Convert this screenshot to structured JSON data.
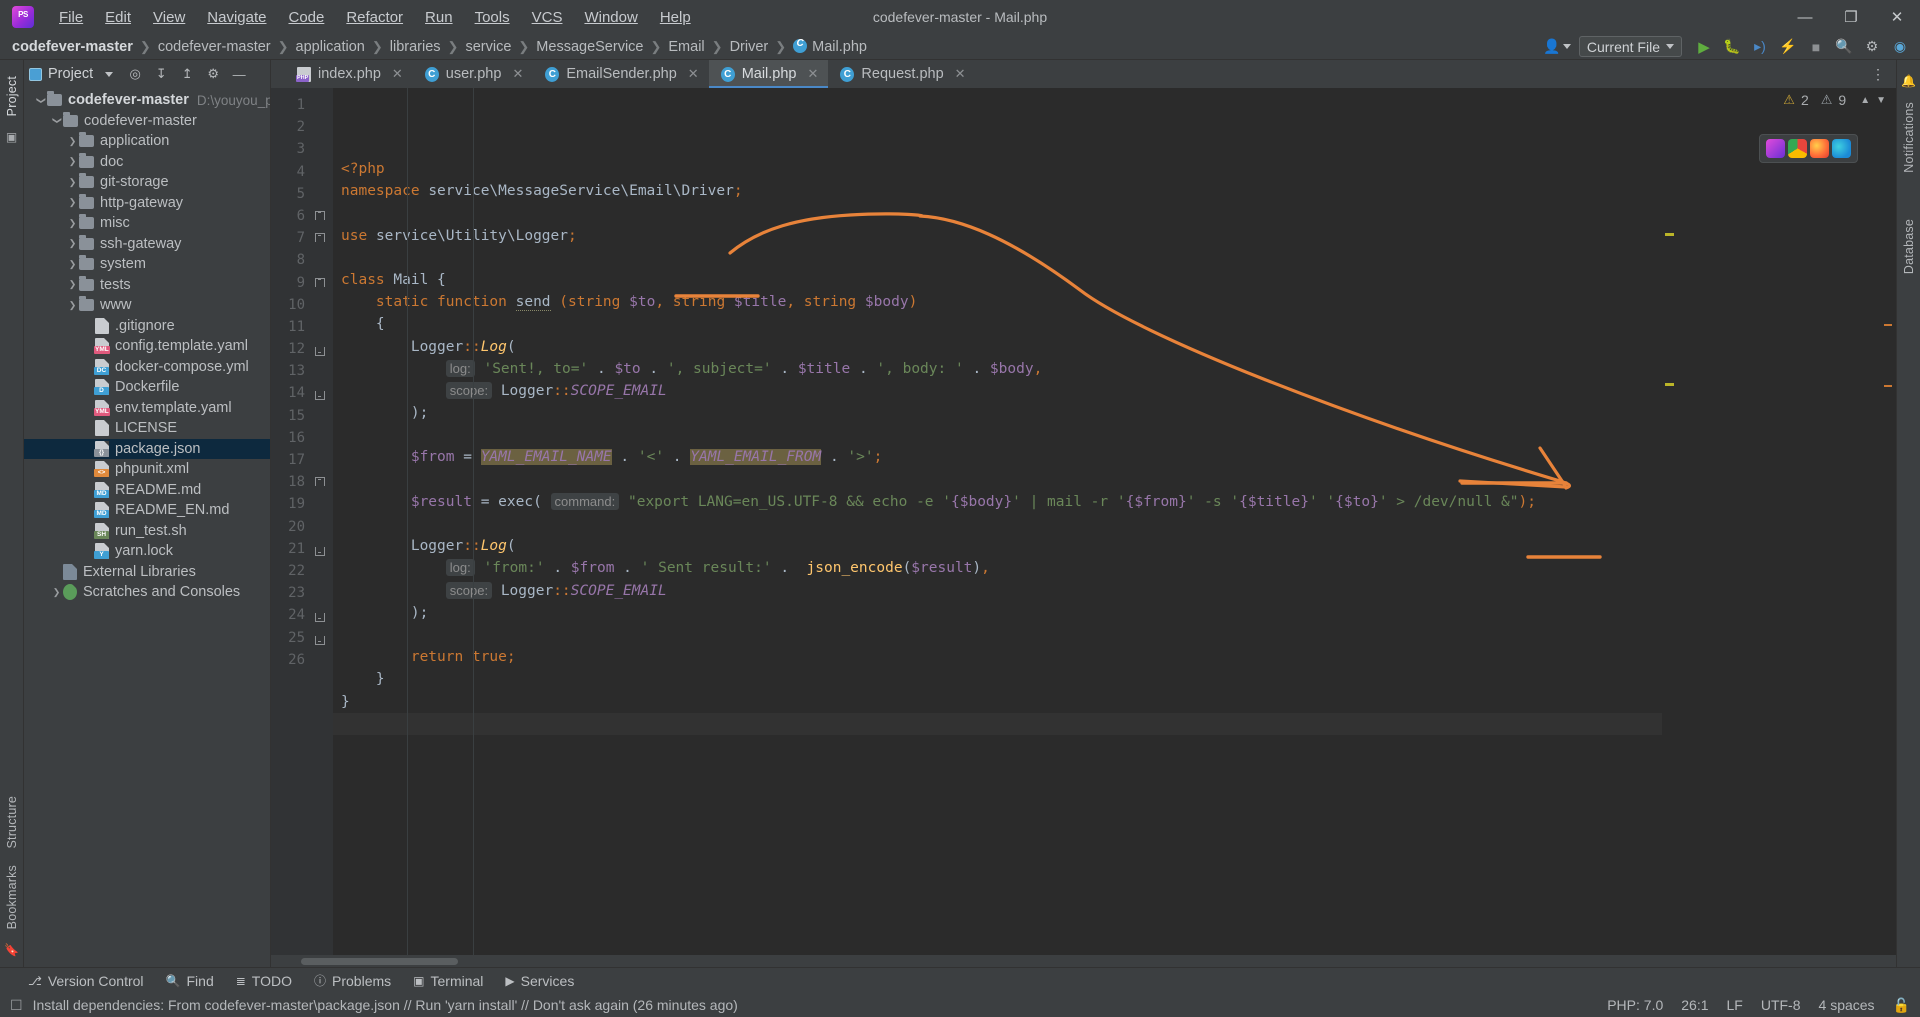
{
  "window": {
    "title": "codefever-master - Mail.php"
  },
  "menu": {
    "items": [
      "File",
      "Edit",
      "View",
      "Navigate",
      "Code",
      "Refactor",
      "Run",
      "Tools",
      "VCS",
      "Window",
      "Help"
    ]
  },
  "window_controls": {
    "minimize": "—",
    "maximize": "❐",
    "close": "✕"
  },
  "breadcrumb": {
    "items": [
      "codefever-master",
      "codefever-master",
      "application",
      "libraries",
      "service",
      "MessageService",
      "Email",
      "Driver"
    ],
    "file": "Mail.php",
    "separator": "❯"
  },
  "navbar_right": {
    "account_icon": "user-icon",
    "run_config": "Current File",
    "run": "run-icon",
    "debug": "debug-icon",
    "run_coverage": "run-coverage-icon",
    "profile": "profile-icon",
    "stop": "stop-icon",
    "search": "search-icon",
    "settings": "gear-icon",
    "plugin": "plugin-icon"
  },
  "rails": {
    "left_top": [
      "Project"
    ],
    "left_bottom": [
      "Structure",
      "Bookmarks"
    ],
    "right": [
      "Notifications",
      "Database"
    ]
  },
  "project_panel": {
    "title": "Project",
    "toolbar": [
      "dropdown-icon",
      "target-icon",
      "expand-all-icon",
      "collapse-all-icon",
      "gear-icon",
      "hide-icon"
    ],
    "tree": [
      {
        "label": "codefever-master",
        "path": "D:\\youyou_pm",
        "type": "root",
        "indent": 0,
        "arrow": "open",
        "bold": true,
        "selected": false
      },
      {
        "label": "codefever-master",
        "type": "folder",
        "indent": 1,
        "arrow": "open",
        "bold": false,
        "selected": false
      },
      {
        "label": "application",
        "type": "folder",
        "indent": 2,
        "arrow": "closed",
        "selected": false
      },
      {
        "label": "doc",
        "type": "folder",
        "indent": 2,
        "arrow": "closed",
        "selected": false
      },
      {
        "label": "git-storage",
        "type": "folder",
        "indent": 2,
        "arrow": "closed",
        "selected": false
      },
      {
        "label": "http-gateway",
        "type": "folder",
        "indent": 2,
        "arrow": "closed",
        "selected": false
      },
      {
        "label": "misc",
        "type": "folder",
        "indent": 2,
        "arrow": "closed",
        "selected": false
      },
      {
        "label": "ssh-gateway",
        "type": "folder",
        "indent": 2,
        "arrow": "closed",
        "selected": false
      },
      {
        "label": "system",
        "type": "folder",
        "indent": 2,
        "arrow": "closed",
        "selected": false
      },
      {
        "label": "tests",
        "type": "folder",
        "indent": 2,
        "arrow": "closed",
        "selected": false
      },
      {
        "label": "www",
        "type": "folder",
        "indent": 2,
        "arrow": "closed",
        "selected": false
      },
      {
        "label": ".gitignore",
        "type": "file",
        "tag": "",
        "tagcolor": "#8a9199",
        "indent": 3,
        "selected": false
      },
      {
        "label": "config.template.yaml",
        "type": "file",
        "tag": "YML",
        "tagcolor": "#e05a7d",
        "indent": 3,
        "selected": false
      },
      {
        "label": "docker-compose.yml",
        "type": "file",
        "tag": "DC",
        "tagcolor": "#3f9fd4",
        "indent": 3,
        "selected": false
      },
      {
        "label": "Dockerfile",
        "type": "file",
        "tag": "D",
        "tagcolor": "#3f9fd4",
        "indent": 3,
        "selected": false
      },
      {
        "label": "env.template.yaml",
        "type": "file",
        "tag": "YML",
        "tagcolor": "#e05a7d",
        "indent": 3,
        "selected": false
      },
      {
        "label": "LICENSE",
        "type": "file",
        "tag": "",
        "tagcolor": "#8a9199",
        "indent": 3,
        "selected": false
      },
      {
        "label": "package.json",
        "type": "file",
        "tag": "{}",
        "tagcolor": "#8a9199",
        "indent": 3,
        "selected": true
      },
      {
        "label": "phpunit.xml",
        "type": "file",
        "tag": "<>",
        "tagcolor": "#e08a3c",
        "indent": 3,
        "selected": false
      },
      {
        "label": "README.md",
        "type": "file",
        "tag": "MD",
        "tagcolor": "#3f9fd4",
        "indent": 3,
        "selected": false
      },
      {
        "label": "README_EN.md",
        "type": "file",
        "tag": "MD",
        "tagcolor": "#3f9fd4",
        "indent": 3,
        "selected": false
      },
      {
        "label": "run_test.sh",
        "type": "file",
        "tag": "SH",
        "tagcolor": "#6a8759",
        "indent": 3,
        "selected": false
      },
      {
        "label": "yarn.lock",
        "type": "file",
        "tag": "Y",
        "tagcolor": "#3f9fd4",
        "indent": 3,
        "selected": false
      },
      {
        "label": "External Libraries",
        "type": "lib",
        "indent": 1,
        "selected": false
      },
      {
        "label": "Scratches and Consoles",
        "type": "scratch",
        "indent": 1,
        "arrow": "closed",
        "selected": false
      }
    ]
  },
  "tabs": [
    {
      "label": "index.php",
      "icon": "php-file-icon",
      "active": false,
      "closeable": true
    },
    {
      "label": "user.php",
      "icon": "php-class-icon",
      "active": false,
      "closeable": true
    },
    {
      "label": "EmailSender.php",
      "icon": "php-class-icon",
      "active": false,
      "closeable": true
    },
    {
      "label": "Mail.php",
      "icon": "php-class-icon",
      "active": true,
      "closeable": true
    },
    {
      "label": "Request.php",
      "icon": "php-class-icon",
      "active": false,
      "closeable": true
    }
  ],
  "editor": {
    "filename": "Mail.php",
    "first_line": 1,
    "last_line": 26,
    "line_numbers": [
      1,
      2,
      3,
      4,
      5,
      6,
      7,
      8,
      9,
      10,
      11,
      12,
      13,
      14,
      15,
      16,
      17,
      18,
      19,
      20,
      21,
      22,
      23,
      24,
      25,
      26
    ],
    "lines": [
      "<?php",
      "namespace service\\MessageService\\Email\\Driver;",
      "",
      "use service\\Utility\\Logger;",
      "",
      "class Mail {",
      "    static function send (string $to, string $title, string $body)",
      "    {",
      "        Logger::Log(",
      "            log: 'Sent!, to=' . $to . ', subject=' . $title . ', body: ' . $body,",
      "            scope: Logger::SCOPE_EMAIL",
      "        );",
      "",
      "        $from = YAML_EMAIL_NAME . '<' . YAML_EMAIL_FROM . '>';",
      "",
      "        $result = exec( command: \"export LANG=en_US.UTF-8 && echo -e '{$body}' | mail -r '{$from}' -s '{$title}' '{$to}' > /dev/null &\");",
      "",
      "        Logger::Log(",
      "            log: 'from:' . $from . ' Sent result:' .  json_encode($result),",
      "            scope: Logger::SCOPE_EMAIL",
      "        );",
      "",
      "        return true;",
      "    }",
      "}",
      ""
    ],
    "inspection": {
      "warnings": "2",
      "weak_warnings": "9",
      "warning_icon": "warning-triangle-icon",
      "weak_icon": "weak-warning-icon",
      "chevron_up": "▲",
      "chevron_down": "▼"
    },
    "browser_popup": [
      "phpstorm-icon",
      "chrome-icon",
      "firefox-icon",
      "edge-icon"
    ]
  },
  "tool_windows": [
    {
      "label": "Version Control",
      "icon": "branch-icon"
    },
    {
      "label": "Find",
      "icon": "search-icon"
    },
    {
      "label": "TODO",
      "icon": "todo-icon"
    },
    {
      "label": "Problems",
      "icon": "problems-icon"
    },
    {
      "label": "Terminal",
      "icon": "terminal-icon"
    },
    {
      "label": "Services",
      "icon": "services-icon"
    }
  ],
  "status_bar": {
    "message": "Install dependencies: From codefever-master\\package.json // Run 'yarn install' // Don't ask again (26 minutes ago)",
    "message_icon": "notification-icon",
    "php_version": "PHP: 7.0",
    "caret": "26:1",
    "line_sep": "LF",
    "encoding": "UTF-8",
    "indent": "4 spaces",
    "lock_icon": "lock-icon"
  },
  "colors": {
    "bg_chrome": "#3c3f41",
    "bg_editor": "#2b2b2b",
    "gutter": "#313335",
    "selection": "#0d293e",
    "accent_tab": "#4a88c7",
    "annotation": "#e8833a",
    "keyword": "#cc7832",
    "string": "#6a8759",
    "variable": "#9876aa",
    "function": "#ffc66d",
    "usage_highlight": "#6b6141"
  }
}
